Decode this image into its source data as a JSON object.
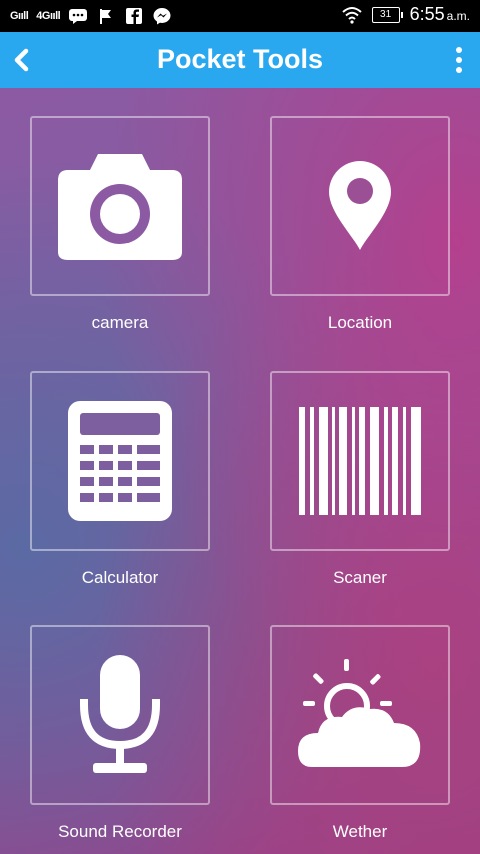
{
  "status_bar": {
    "signal1": "Gııll",
    "signal2": "4Gııll",
    "battery": "31",
    "time": "6:55",
    "ampm": "a.m."
  },
  "app_bar": {
    "title": "Pocket Tools"
  },
  "tools": [
    {
      "label": "camera",
      "icon": "camera-icon"
    },
    {
      "label": "Location",
      "icon": "location-pin-icon"
    },
    {
      "label": "Calculator",
      "icon": "calculator-icon"
    },
    {
      "label": "Scaner",
      "icon": "barcode-icon"
    },
    {
      "label": "Sound Recorder",
      "icon": "microphone-icon"
    },
    {
      "label": "Wether",
      "icon": "weather-icon"
    }
  ],
  "colors": {
    "app_bar": "#29a8ef",
    "background": "#8b5aa0",
    "icon": "#ffffff"
  }
}
